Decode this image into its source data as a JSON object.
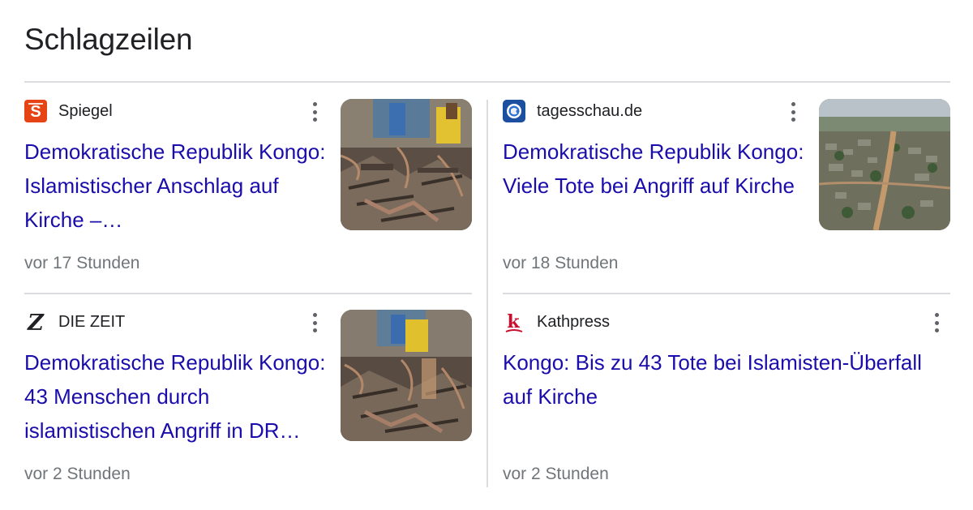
{
  "section_title": "Schlagzeilen",
  "cards": [
    {
      "source": "Spiegel",
      "logo_icon": "spiegel-logo-icon",
      "logo_color": "#e64415",
      "headline": "Demokratische Republik Kongo: Islamistischer Anschlag auf Kirche –…",
      "time": "vor 17 Stunden",
      "thumbnail": "burned-church-interior-image"
    },
    {
      "source": "tagesschau.de",
      "logo_icon": "tagesschau-logo-icon",
      "logo_color": "#1c4fa0",
      "headline": "Demokratische Republik Kongo: Viele Tote bei Angriff auf Kirche",
      "time": "vor 18 Stunden",
      "thumbnail": "aerial-town-image"
    },
    {
      "source": "DIE ZEIT",
      "logo_icon": "zeit-logo-icon",
      "logo_color": "#202124",
      "headline": "Demokratische Republik Kongo: 43 Menschen durch islamistischen Angriff in DR…",
      "time": "vor 2 Stunden",
      "thumbnail": "burned-church-interior-image"
    },
    {
      "source": "Kathpress",
      "logo_icon": "kathpress-logo-icon",
      "logo_color": "#c8102e",
      "headline": "Kongo: Bis zu 43 Tote bei Islamisten-Überfall auf Kirche",
      "time": "vor 2 Stunden"
    }
  ],
  "colors": {
    "headline": "#1a0dab",
    "meta": "#70757a",
    "divider": "#dadce0"
  }
}
